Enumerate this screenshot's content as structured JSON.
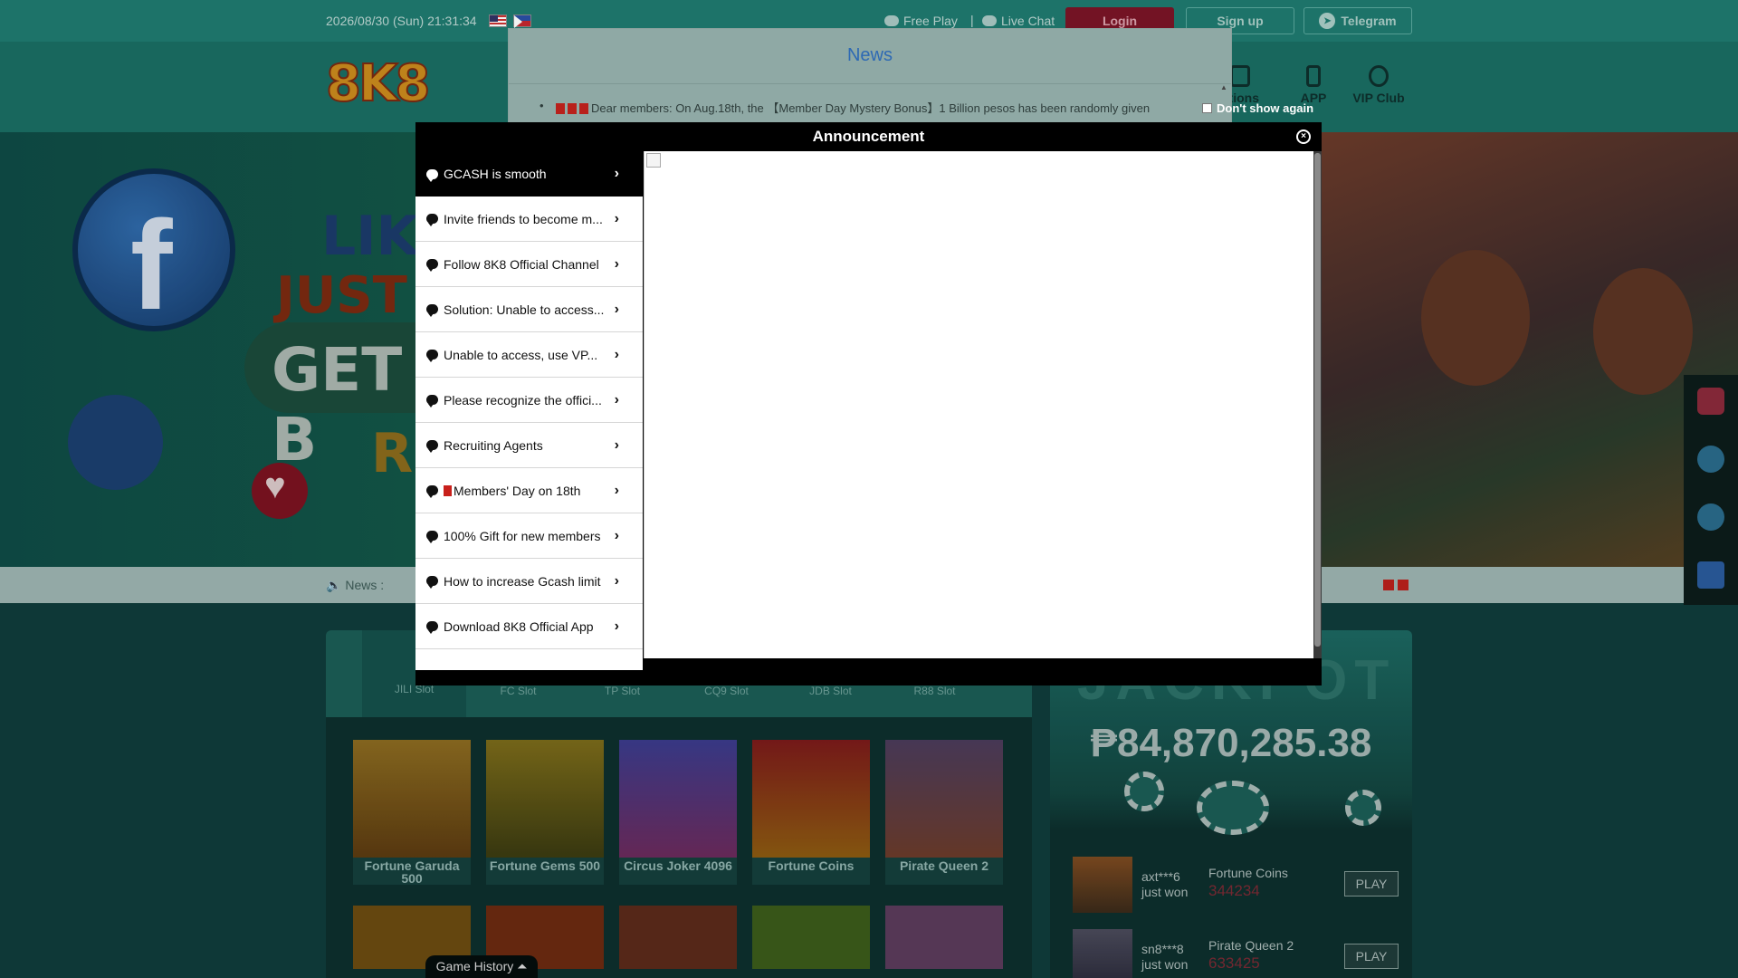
{
  "topbar": {
    "datetime": "2026/08/30 (Sun) 21:31:34",
    "free_play": "Free Play",
    "live_chat": "Live Chat",
    "separator": "|",
    "login": "Login",
    "signup": "Sign up",
    "telegram": "Telegram"
  },
  "header": {
    "logo": "8K8",
    "nav": [
      "otions",
      "APP",
      "VIP Club"
    ]
  },
  "banner": {
    "line1": "LIK",
    "line2": "JUST",
    "line3": "GET B",
    "line4": "R"
  },
  "newsbar": {
    "label": "News :"
  },
  "games": {
    "tabs": [
      "JILI Slot",
      "FC Slot",
      "TP Slot",
      "CQ9 Slot",
      "JDB Slot",
      "R88 Slot"
    ],
    "cards": [
      "Fortune Garuda 500",
      "Fortune Gems 500",
      "Circus Joker 4096",
      "Fortune Coins",
      "Pirate Queen 2"
    ]
  },
  "jackpot": {
    "title": "JACKPOT",
    "amount": "₱84,870,285.38",
    "winners": [
      {
        "user": "axt***6",
        "suffix": "just won",
        "game": "Fortune Coins",
        "amount": "344234",
        "play": "PLAY"
      },
      {
        "user": "sn8***8",
        "suffix": "just won",
        "game": "Pirate Queen 2",
        "amount": "633425",
        "play": "PLAY"
      }
    ]
  },
  "game_history": "Game History ⏶",
  "news_modal": {
    "title": "News",
    "item": "Dear members: On Aug.18th, the 【Member Day Mystery Bonus】1 Billion pesos has been randomly given",
    "dont_show": "Don't show again"
  },
  "announcement": {
    "title": "Announcement",
    "items": [
      "GCASH is smooth",
      "Invite friends to become m...",
      "Follow 8K8 Official Channel",
      "Solution: Unable to access...",
      "Unable to access, use VP...",
      "Please recognize the offici...",
      "Recruiting Agents",
      "Members' Day on 18th",
      "100% Gift for new members",
      "How to increase Gcash limit",
      "Download 8K8 Official App"
    ]
  }
}
